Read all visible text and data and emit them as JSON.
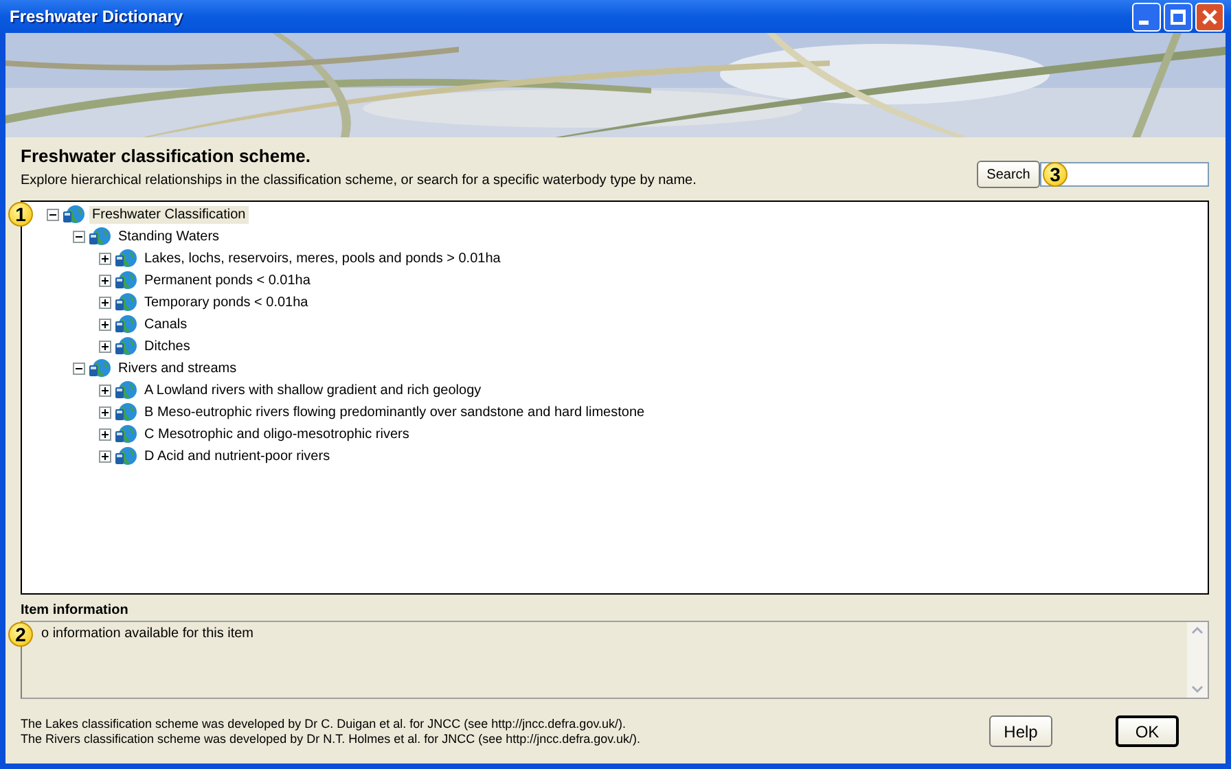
{
  "window": {
    "title": "Freshwater Dictionary"
  },
  "header": {
    "title": "Freshwater classification scheme.",
    "description": "Explore hierarchical relationships in the classification scheme, or search for a specific waterbody type by name."
  },
  "search": {
    "button": "Search",
    "callout": "3"
  },
  "tree": {
    "callout": "1",
    "items": [
      {
        "label": "Freshwater Classification",
        "expanded": true,
        "selected": true,
        "children": [
          {
            "label": "Standing Waters",
            "expanded": true,
            "selected": false,
            "children": [
              {
                "label": "Lakes, lochs, reservoirs, meres, pools and ponds > 0.01ha",
                "expanded": false,
                "selected": false
              },
              {
                "label": "Permanent ponds < 0.01ha",
                "expanded": false,
                "selected": false
              },
              {
                "label": "Temporary ponds < 0.01ha",
                "expanded": false,
                "selected": false
              },
              {
                "label": "Canals",
                "expanded": false,
                "selected": false
              },
              {
                "label": "Ditches",
                "expanded": false,
                "selected": false
              }
            ]
          },
          {
            "label": "Rivers and streams",
            "expanded": true,
            "selected": false,
            "children": [
              {
                "label": "A Lowland rivers with shallow gradient and rich geology",
                "expanded": false,
                "selected": false
              },
              {
                "label": "B Meso-eutrophic rivers flowing predominantly over sandstone and hard limestone",
                "expanded": false,
                "selected": false
              },
              {
                "label": "C Mesotrophic and oligo-mesotrophic rivers",
                "expanded": false,
                "selected": false
              },
              {
                "label": "D Acid and nutrient-poor rivers",
                "expanded": false,
                "selected": false
              }
            ]
          }
        ]
      }
    ]
  },
  "item_information": {
    "label": "Item information",
    "callout": "2",
    "text": "o information available for this item"
  },
  "footer": {
    "lines": [
      "The Lakes classification scheme was developed by Dr C. Duigan et al. for JNCC  (see http://jncc.defra.gov.uk/).",
      "The Rivers classification scheme was developed by Dr N.T. Holmes et al. for JNCC  (see http://jncc.defra.gov.uk/)."
    ],
    "buttons": [
      "Help",
      "OK"
    ]
  }
}
